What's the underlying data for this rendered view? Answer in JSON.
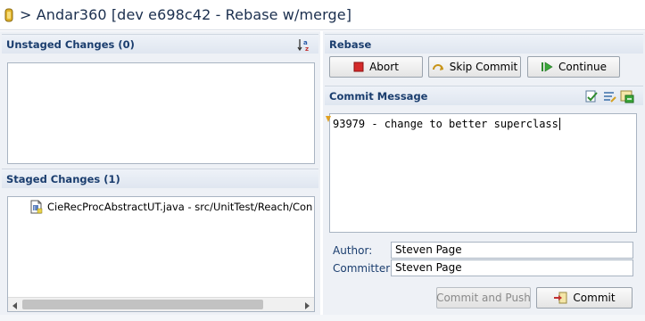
{
  "title": "> Andar360 [dev e698c42 - Rebase w/merge]",
  "unstaged": {
    "header": "Unstaged Changes (0)",
    "sort_icon": "sort-alpha-icon",
    "files": []
  },
  "staged": {
    "header": "Staged Changes (1)",
    "files": [
      {
        "label": "CieRecProcAbstractUT.java - src/UnitTest/Reach/Connec",
        "icon": "java-file-icon"
      }
    ]
  },
  "rebase": {
    "header": "Rebase",
    "abort_label": "Abort",
    "skip_label": "Skip Commit",
    "continue_label": "Continue"
  },
  "commit": {
    "header": "Commit Message",
    "message": "93979 - change to better superclass",
    "author_label": "Author:",
    "author_value": "Steven Page",
    "committer_label": "Committer:",
    "committer_value": "Steven Page",
    "commit_push_label": "Commit and Push",
    "commit_label": "Commit"
  },
  "colors": {
    "title": "#1b2f4e",
    "header_text": "#1a3d6e",
    "abort_red": "#d42a2a"
  }
}
